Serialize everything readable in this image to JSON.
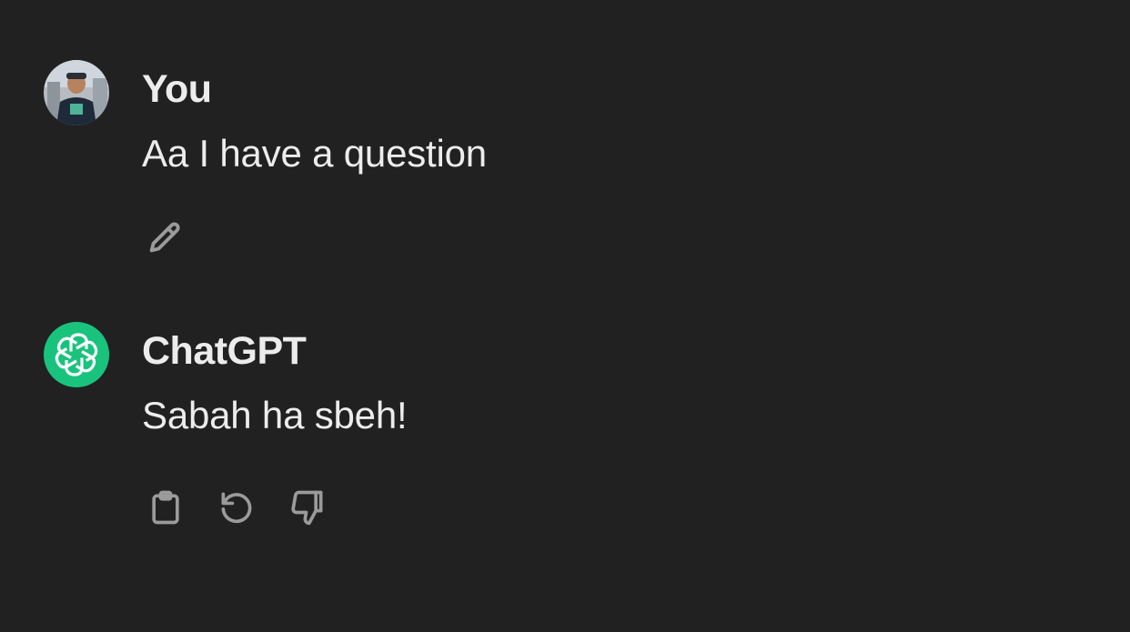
{
  "theme": {
    "background": "#212121",
    "text": "#ececec",
    "icon": "#9b9b9b",
    "assistant_accent": "#19c37d"
  },
  "messages": [
    {
      "role": "user",
      "author": "You",
      "text": "Aa I have a question",
      "actions": [
        "pencil-icon"
      ]
    },
    {
      "role": "assistant",
      "author": "ChatGPT",
      "text": "Sabah ha sbeh!",
      "actions": [
        "clipboard-icon",
        "refresh-icon",
        "thumbs-down-icon"
      ]
    }
  ]
}
